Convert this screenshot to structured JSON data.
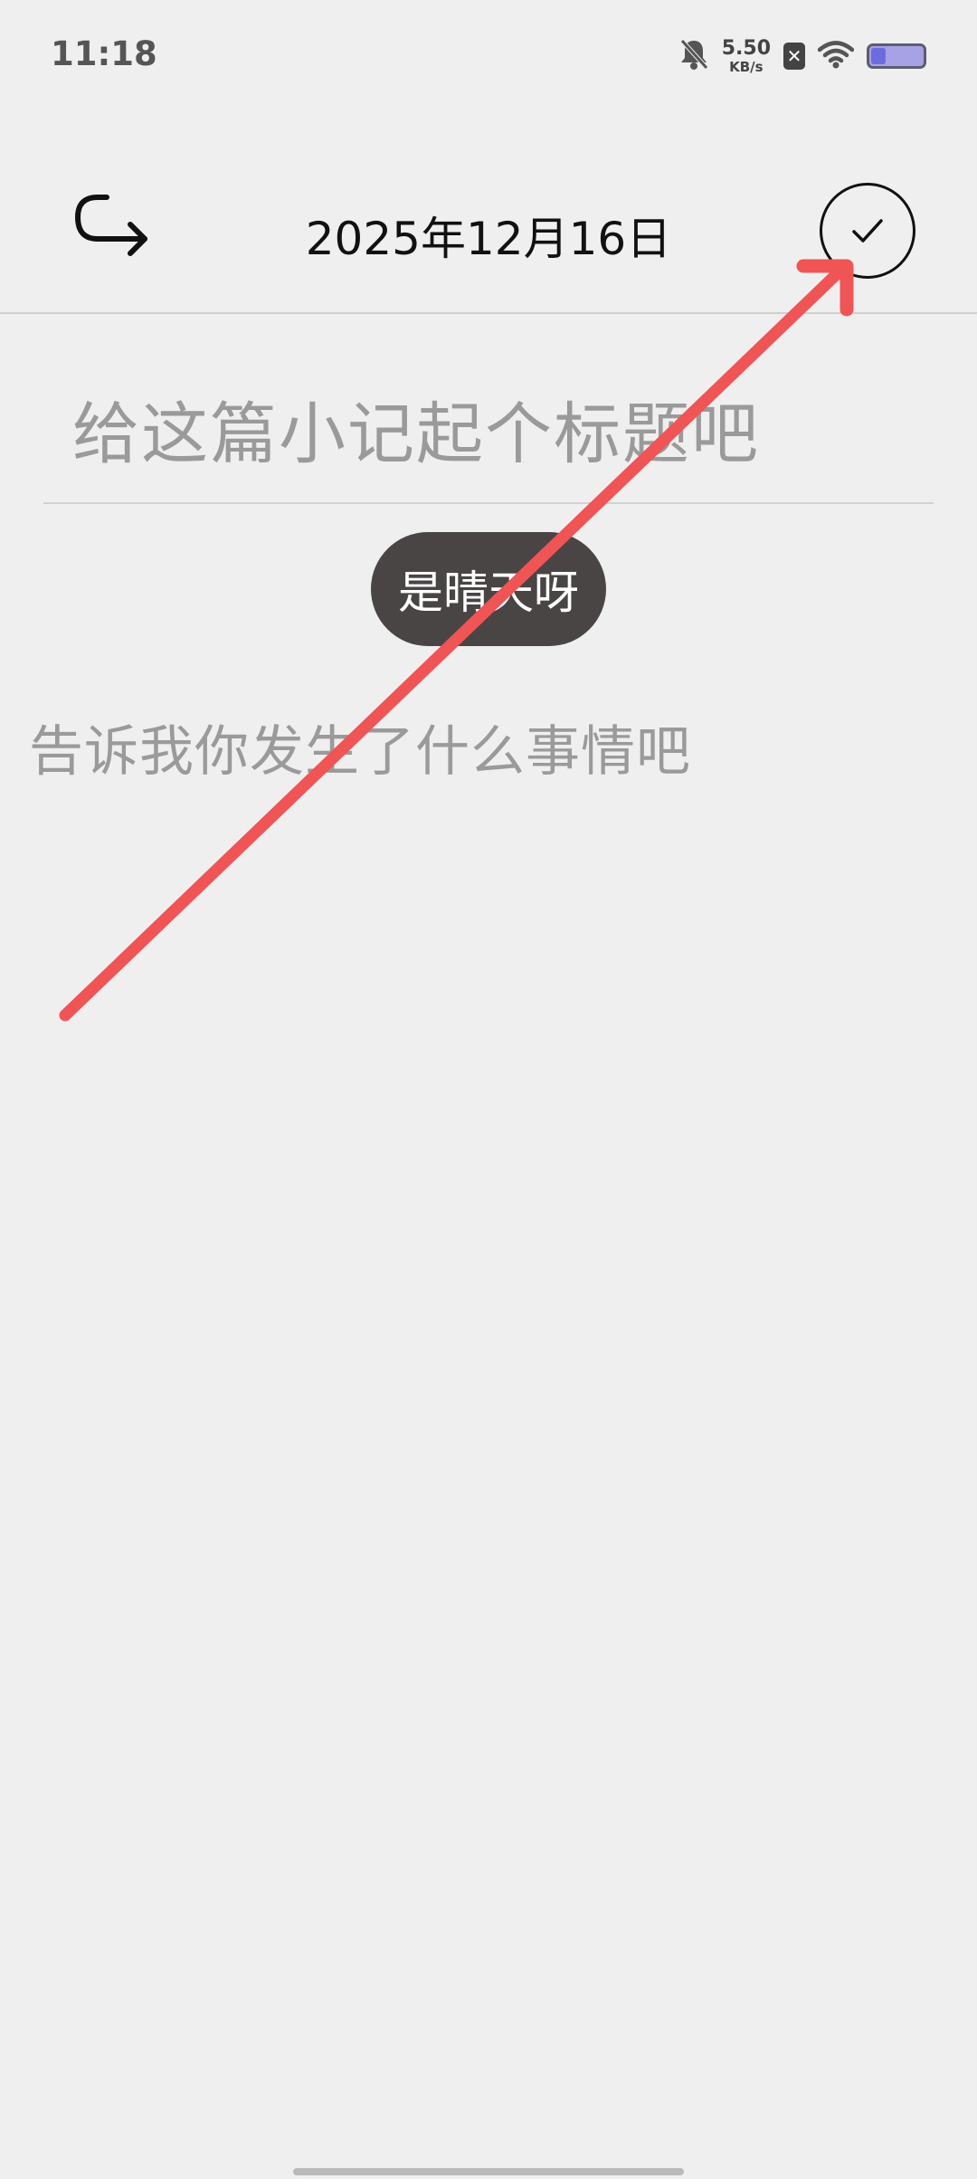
{
  "status_bar": {
    "time": "11:18",
    "net_speed_value": "5.50",
    "net_speed_unit": "KB/s",
    "sim_icon": "sim-x-icon",
    "battery_color": "#a7a2e6"
  },
  "header": {
    "title": "2025年12月16日",
    "back_icon": "back-arrow-icon",
    "confirm_icon": "check-circle-icon"
  },
  "editor": {
    "title_placeholder": "给这篇小记起个标题吧",
    "weather_label": "是晴天呀",
    "body_placeholder": "告诉我你发生了什么事情吧"
  },
  "annotation": {
    "arrow_color": "#f05454"
  }
}
